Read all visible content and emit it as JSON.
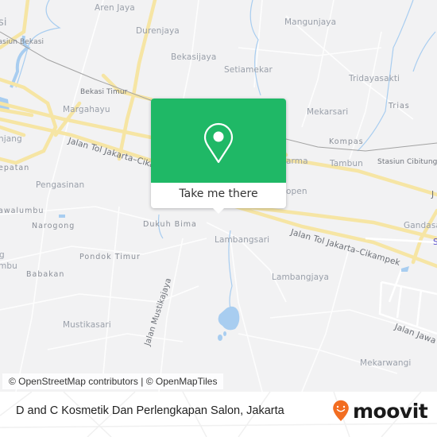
{
  "map": {
    "labels": {
      "bekasi": "si",
      "stasiun_bekasi": "Stasiun Bekasi",
      "aren_jaya": "Aren Jaya",
      "durenjaya": "Durenjaya",
      "bekasijaya": "Bekasijaya",
      "mangunjaya": "Mangunjaya",
      "setiamekar": "Setiamekar",
      "tridayasakti": "Tridayasakti",
      "trias": "Trias",
      "mekarsari": "Mekarsari",
      "bekasi_timur": "Bekasi Timur",
      "margahayu": "Margahayu",
      "kompas": "Kompas",
      "tambun": "Tambun",
      "stasiun_cibitung": "Stasiun Cibitung",
      "arma": "arma",
      "open": "open",
      "njang": "njang",
      "epatan": "epatan",
      "pengasinan": "Pengasinan",
      "awalumbu": "awalumbu",
      "narogong": "Narogong",
      "g": "g",
      "mbu": "mbu",
      "dukuh_bima": "Dukuh Bima",
      "pondok_timur": "Pondok Timur",
      "babakan": "Babakan",
      "lambangsari": "Lambangsari",
      "lambangjaya": "Lambangjaya",
      "gandasa": "Gandasa",
      "mustikasari": "Mustikasari",
      "mekarwangi": "Mekarwangi",
      "j": "J",
      "s": "S"
    },
    "roads": {
      "tol_west": "Jalan Tol Jakarta–Cika",
      "tol_east": "Jalan Tol Jakarta–Cikampek",
      "mustikajaya": "Jalan Mustikajaya",
      "jawa": "Jalan Jawa"
    },
    "popup": {
      "icon": "location-pin-icon",
      "button_label": "Take me there",
      "color": "#1fb866"
    },
    "attribution": "© OpenStreetMap contributors | © OpenMapTiles"
  },
  "footer": {
    "place_name": "D and C Kosmetik Dan Perlengkapan Salon, Jakarta",
    "brand": "moovit",
    "brand_color": "#f26d21"
  }
}
